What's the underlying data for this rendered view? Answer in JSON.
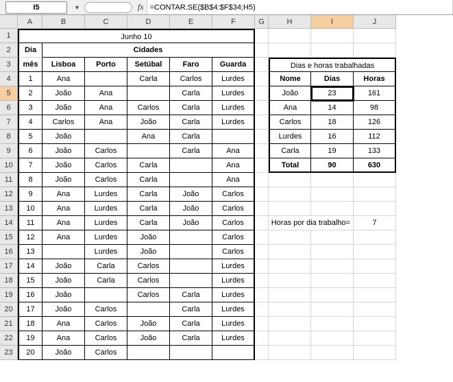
{
  "namebox": "I5",
  "fx": "fx",
  "formula": "=CONTAR.SE($B$4:$F$34;H5)",
  "cols": [
    "A",
    "B",
    "C",
    "D",
    "E",
    "F",
    "G",
    "H",
    "I",
    "J"
  ],
  "rowcount": 23,
  "title": "Junho 10",
  "cidades": "Cidades",
  "dia": "Dia",
  "mes": "mês",
  "h": {
    "lisboa": "Lisboa",
    "porto": "Porto",
    "setubal": "Setúbal",
    "faro": "Faro",
    "guarda": "Guarda"
  },
  "r": [
    {
      "n": "1",
      "b": "Ana",
      "c": "",
      "d": "Carla",
      "e": "Carlos",
      "f": "Lurdes"
    },
    {
      "n": "2",
      "b": "João",
      "c": "Ana",
      "d": "",
      "e": "Carla",
      "f": "Lurdes"
    },
    {
      "n": "3",
      "b": "João",
      "c": "Ana",
      "d": "Carlos",
      "e": "Carla",
      "f": "Lurdes"
    },
    {
      "n": "4",
      "b": "Carlos",
      "c": "Ana",
      "d": "João",
      "e": "Carla",
      "f": "Lurdes"
    },
    {
      "n": "5",
      "b": "João",
      "c": "",
      "d": "Ana",
      "e": "Carla",
      "f": ""
    },
    {
      "n": "6",
      "b": "João",
      "c": "Carlos",
      "d": "",
      "e": "Carla",
      "f": "Ana"
    },
    {
      "n": "7",
      "b": "João",
      "c": "Carlos",
      "d": "Carla",
      "e": "",
      "f": "Ana"
    },
    {
      "n": "8",
      "b": "João",
      "c": "Carlos",
      "d": "Carla",
      "e": "",
      "f": "Ana"
    },
    {
      "n": "9",
      "b": "Ana",
      "c": "Lurdes",
      "d": "Carla",
      "e": "João",
      "f": "Carlos"
    },
    {
      "n": "10",
      "b": "Ana",
      "c": "Lurdes",
      "d": "Carla",
      "e": "João",
      "f": "Carlos"
    },
    {
      "n": "11",
      "b": "Ana",
      "c": "Lurdes",
      "d": "Carla",
      "e": "João",
      "f": "Carlos"
    },
    {
      "n": "12",
      "b": "Ana",
      "c": "Lurdes",
      "d": "João",
      "e": "",
      "f": "Carlos"
    },
    {
      "n": "13",
      "b": "",
      "c": "Lurdes",
      "d": "João",
      "e": "",
      "f": "Carlos"
    },
    {
      "n": "14",
      "b": "João",
      "c": "Carla",
      "d": "Carlos",
      "e": "",
      "f": "Lurdes"
    },
    {
      "n": "15",
      "b": "João",
      "c": "Carla",
      "d": "Carlos",
      "e": "",
      "f": "Lurdes"
    },
    {
      "n": "16",
      "b": "João",
      "c": "",
      "d": "Carlos",
      "e": "Carla",
      "f": "Lurdes"
    },
    {
      "n": "17",
      "b": "João",
      "c": "Carlos",
      "d": "",
      "e": "Carla",
      "f": "Lurdes"
    },
    {
      "n": "18",
      "b": "Ana",
      "c": "Carlos",
      "d": "João",
      "e": "Carla",
      "f": "Lurdes"
    },
    {
      "n": "19",
      "b": "Ana",
      "c": "Carlos",
      "d": "João",
      "e": "Carla",
      "f": "Lurdes"
    },
    {
      "n": "20",
      "b": "João",
      "c": "Carlos",
      "d": "",
      "e": "",
      "f": ""
    }
  ],
  "t2": {
    "title": "Dias e horas trabalhadas",
    "nome": "Nome",
    "dias": "Dias",
    "horas": "Horas",
    "rows": [
      {
        "n": "João",
        "d": "23",
        "h": "161"
      },
      {
        "n": "Ana",
        "d": "14",
        "h": "98"
      },
      {
        "n": "Carlos",
        "d": "18",
        "h": "126"
      },
      {
        "n": "Lurdes",
        "d": "16",
        "h": "112"
      },
      {
        "n": "Carla",
        "d": "19",
        "h": "133"
      }
    ],
    "total": "Total",
    "tsum_d": "90",
    "tsum_h": "630"
  },
  "hpd_label": "Horas por dia trabalho=",
  "hpd_val": "7"
}
